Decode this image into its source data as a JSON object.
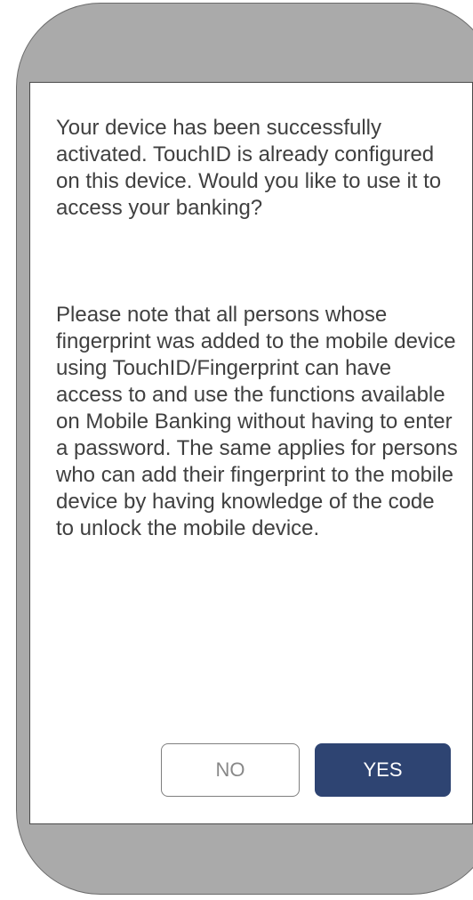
{
  "dialog": {
    "message_paragraphs": [
      "Your device has been successfully activated. TouchID is already configured on this device. Would you like to use it to access your banking?",
      "Please note that all persons whose fingerprint was added to the mobile device using TouchID/Fingerprint can have access to and use the functions available on Mobile Banking without having to enter a password. The same applies for persons who can add their fingerprint to the mobile device by having knowledge of the code to unlock the mobile device."
    ],
    "no_label": "NO",
    "yes_label": "YES"
  },
  "colors": {
    "device_body": "#aaaaaa",
    "screen_background": "#ffffff",
    "text": "#404040",
    "primary_button": "#2e4472",
    "secondary_button_border": "#7f7f7f"
  }
}
